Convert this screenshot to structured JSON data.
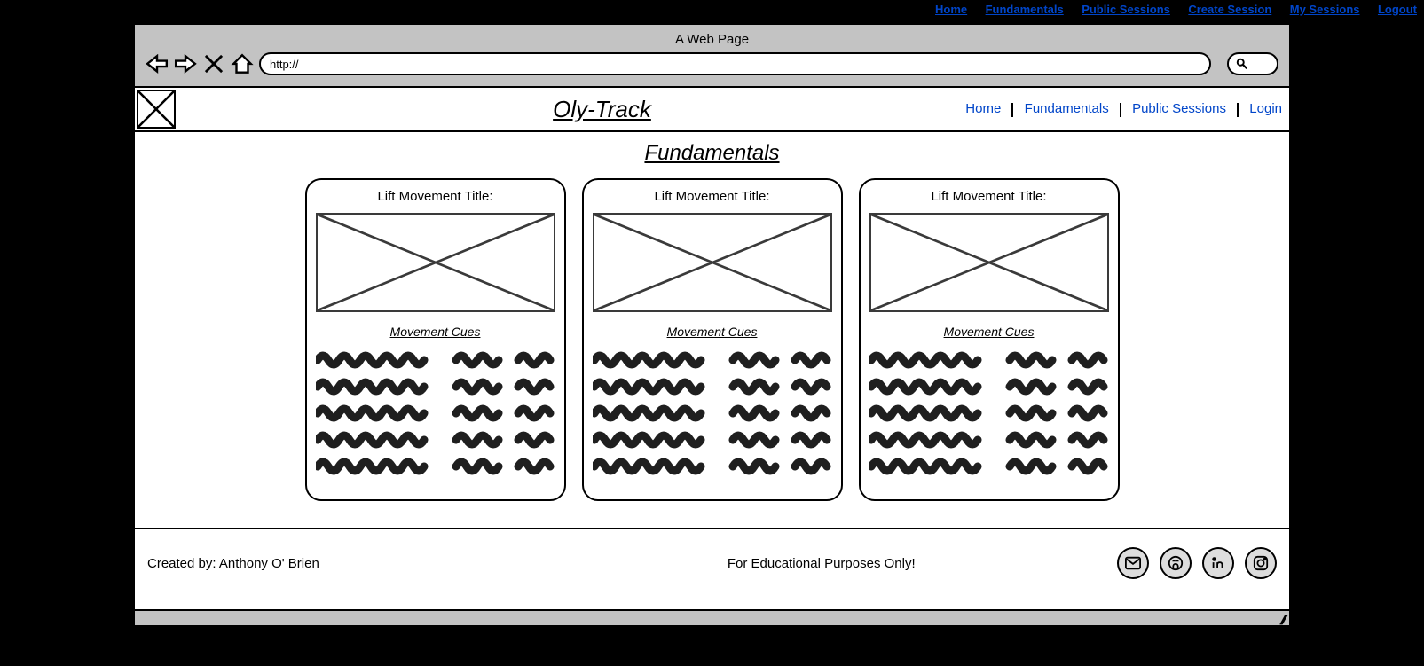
{
  "top_nav": {
    "items": [
      "Home",
      "Fundamentals",
      "Public Sessions",
      "Create Session",
      "My Sessions",
      "Logout"
    ]
  },
  "browser": {
    "title": "A Web Page",
    "url": "http://"
  },
  "header": {
    "site_title": "Oly-Track",
    "nav": [
      "Home",
      "Fundamentals",
      "Public Sessions",
      "Login"
    ]
  },
  "main": {
    "page_title": "Fundamentals",
    "cards": [
      {
        "title": "Lift Movement Title:",
        "cues_label": "Movement Cues"
      },
      {
        "title": "Lift Movement Title:",
        "cues_label": "Movement Cues"
      },
      {
        "title": "Lift Movement Title:",
        "cues_label": "Movement Cues"
      }
    ]
  },
  "footer": {
    "created_by": "Created by: Anthony O' Brien",
    "note": "For Educational Purposes Only!"
  },
  "icons": {
    "social": [
      "mail-icon",
      "github-icon",
      "linkedin-icon",
      "instagram-icon"
    ]
  }
}
